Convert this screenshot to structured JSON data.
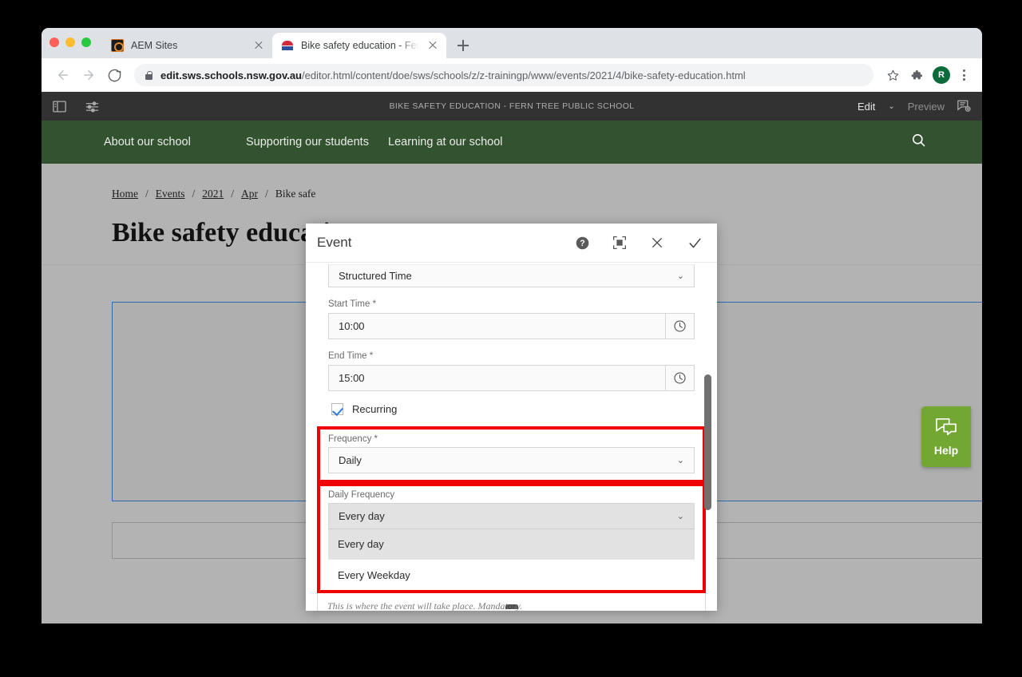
{
  "browser": {
    "tabs": [
      {
        "title": "AEM Sites",
        "favicon": "aem-icon",
        "active": false
      },
      {
        "title": "Bike safety education - Fern Tr",
        "favicon": "school-crest-icon",
        "active": true
      }
    ],
    "new_tab_label": "+",
    "nav": {
      "back": "←",
      "forward": "→",
      "reload": "↻"
    },
    "omnibox": {
      "lock": "lock-icon",
      "host": "edit.sws.schools.nsw.gov.au",
      "path": "/editor.html/content/doe/sws/schools/z/z-trainingp/www/events/2021/4/bike-safety-education.html",
      "bookmark_icon": "☆",
      "extensions_icon": "puzzle-icon",
      "avatar_initial": "R"
    }
  },
  "aem_toolbar": {
    "sidepanel_icon": "side-panel-icon",
    "settings_icon": "page-properties-icon",
    "title": "BIKE SAFETY EDUCATION - FERN TREE PUBLIC SCHOOL",
    "edit_label": "Edit",
    "edit_caret": "⌄",
    "preview_label": "Preview",
    "annotate_icon": "annotate-icon"
  },
  "site_nav": {
    "items": [
      "About our school",
      "Supporting our students",
      "Learning at our school"
    ],
    "search_icon": "search-icon"
  },
  "page": {
    "breadcrumb": {
      "links": [
        "Home",
        "Events",
        "2021",
        "Apr"
      ],
      "separator": "/",
      "current": "Bike safe"
    },
    "title": "Bike safety educatio",
    "help_widget": {
      "icon": "chat-bubbles-icon",
      "label": "Help",
      "color": "#72a832"
    }
  },
  "dialog": {
    "title": "Event",
    "actions": {
      "help": "help-icon",
      "fullscreen": "fullscreen-icon",
      "close": "close-icon",
      "confirm": "check-icon"
    },
    "fields": {
      "event_type": {
        "value": "Structured Time",
        "caret": "⌄"
      },
      "start_time": {
        "label": "Start Time *",
        "value": "10:00",
        "addon_icon": "clock-icon"
      },
      "end_time": {
        "label": "End Time *",
        "value": "15:00",
        "addon_icon": "clock-icon"
      },
      "recurring": {
        "label": "Recurring",
        "checked": true
      },
      "frequency": {
        "label": "Frequency *",
        "value": "Daily",
        "caret": "⌄",
        "highlighted": true
      },
      "daily_frequency": {
        "label": "Daily Frequency",
        "value": "Every day",
        "caret": "⌄",
        "highlighted": true,
        "options": [
          {
            "label": "Every day",
            "selected": true
          },
          {
            "label": "Every Weekday",
            "selected": false
          }
        ]
      },
      "location_hint": {
        "text": "This is where the event will take place. Mandatory."
      }
    },
    "highlight_color": "#f00000"
  }
}
